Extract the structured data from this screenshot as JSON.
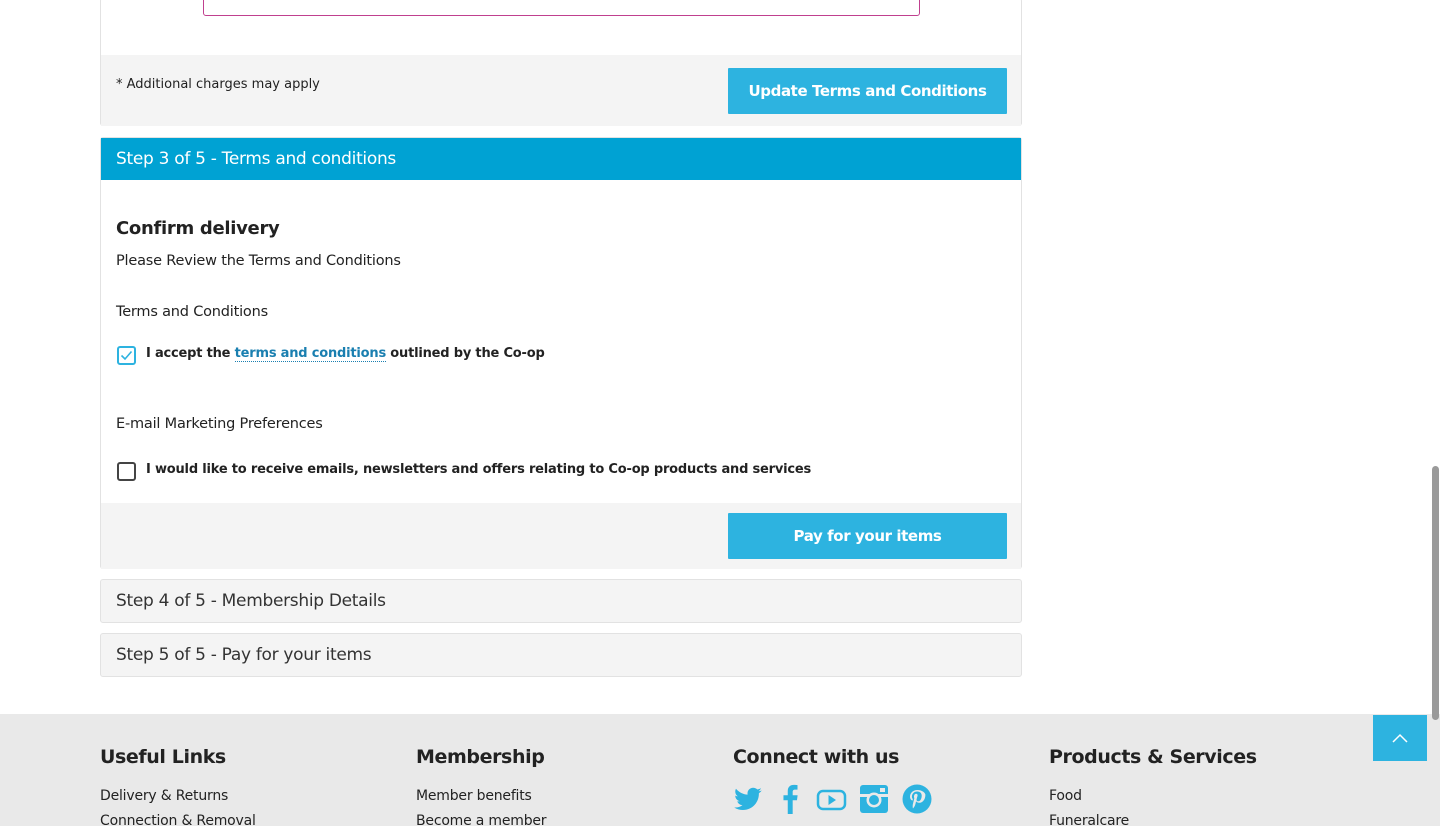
{
  "step2": {
    "note": "* Additional charges may apply",
    "update_button": "Update Terms and Conditions"
  },
  "step3": {
    "header": "Step 3 of 5 - Terms and conditions",
    "title": "Confirm delivery",
    "subtitle": "Please Review the Terms and Conditions",
    "terms_heading": "Terms and Conditions",
    "terms_checkbox": {
      "checked": true,
      "prefix": "I accept the ",
      "link": "terms and conditions",
      "suffix": " outlined by the Co-op"
    },
    "email_heading": "E-mail Marketing Preferences",
    "email_checkbox": {
      "checked": false,
      "label": "I would like to receive emails, newsletters and offers relating to Co-op products and services"
    },
    "pay_button": "Pay for your items"
  },
  "step4": {
    "header": "Step 4 of 5 - Membership Details"
  },
  "step5": {
    "header": "Step 5 of 5 - Pay for your items"
  },
  "footer": {
    "useful_links": {
      "title": "Useful Links",
      "items": [
        "Delivery & Returns",
        "Connection & Removal"
      ]
    },
    "membership": {
      "title": "Membership",
      "items": [
        "Member benefits",
        "Become a member"
      ]
    },
    "connect": {
      "title": "Connect with us",
      "icons": [
        "twitter-icon",
        "facebook-icon",
        "youtube-icon",
        "instagram-icon",
        "pinterest-icon"
      ]
    },
    "products": {
      "title": "Products & Services",
      "items": [
        "Food",
        "Funeralcare"
      ]
    }
  },
  "colors": {
    "accent": "#2db3e0",
    "header_blue": "#00a2d3",
    "magenta_border": "#c0408f"
  }
}
